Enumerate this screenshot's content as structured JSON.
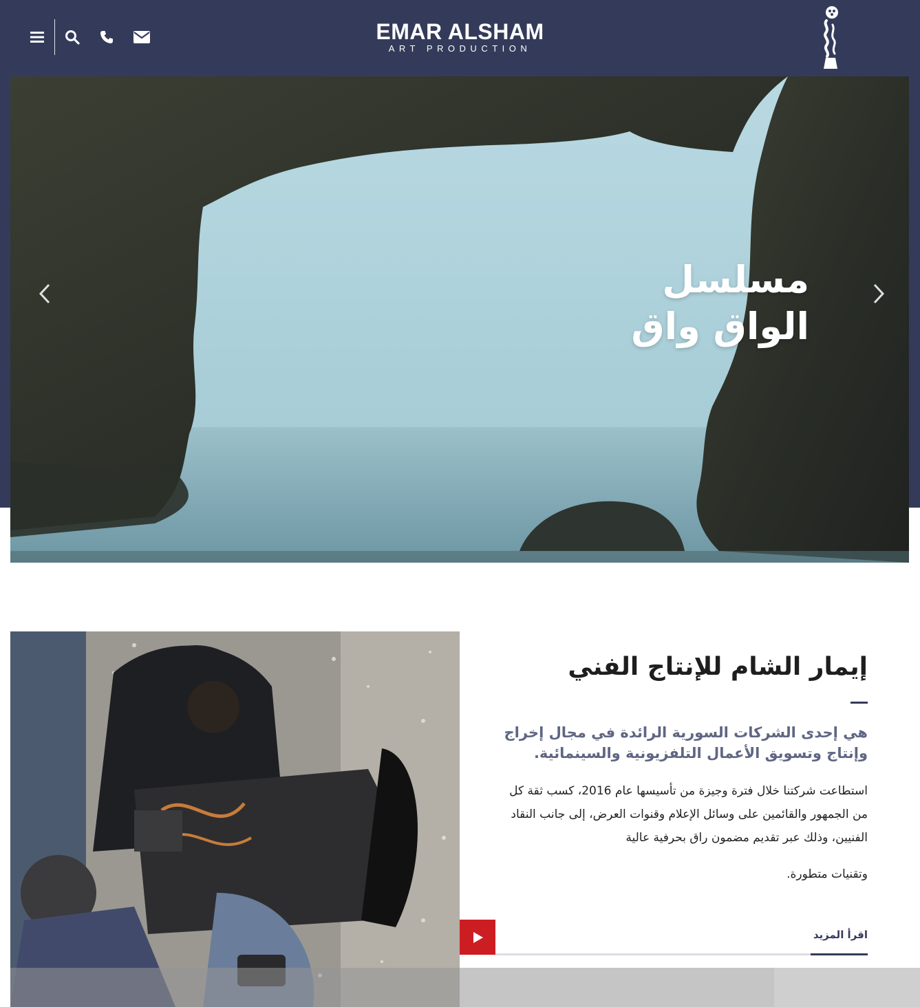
{
  "header": {
    "logo_line1": "EMAR ALSHAM",
    "logo_line2": "ART PRODUCTION",
    "icons": [
      "menu-icon",
      "search-icon",
      "phone-icon",
      "mail-icon"
    ],
    "brand_color": "#343b5a"
  },
  "hero": {
    "title_line1": "مسلسل",
    "title_line2": "الواق واق",
    "prev_icon": "chevron-left-icon",
    "next_icon": "chevron-right-icon"
  },
  "about": {
    "title": "إيمار الشام للإنتاج الفني",
    "subtitle": "هي إحدى الشركات السورية الرائدة في مجال إخراج وإنتاج وتسويق الأعمال التلفزيونية والسينمائية.",
    "body": "استطاعت شركتنا خلال فترة وجيزة من تأسيسها عام 2016، كسب ثقة كل من الجمهور والقائمين على وسائل الإعلام وقنوات العرض، إلى جانب النقاد الفنيين، وذلك عبر تقديم مضمون راق بحرفية عالية",
    "body_last": "وتقنيات متطورة.",
    "read_more": "اقرأ المزيد",
    "play_icon": "play-icon",
    "accent_color": "#cc1e22"
  }
}
